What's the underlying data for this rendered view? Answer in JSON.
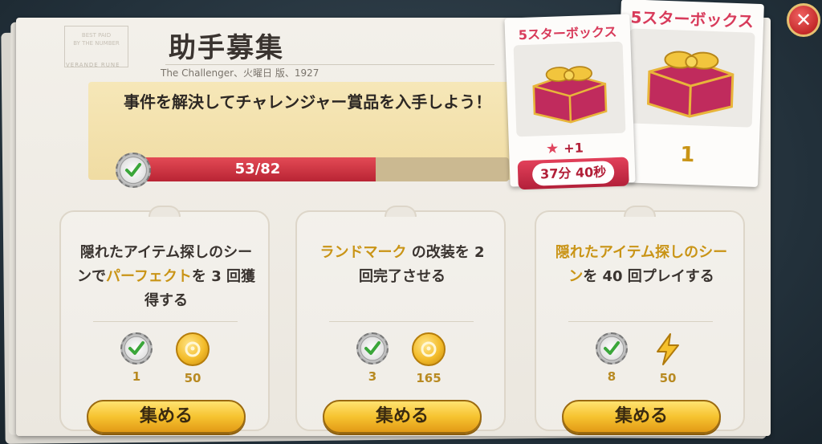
{
  "header": {
    "title": "助手募集",
    "subtitle": "The Challenger、火曜日 版、1927",
    "stamp_lines": [
      "BEST PAID",
      "BY THE NUMBER"
    ],
    "stamp_footer": "VERANDE RUNE"
  },
  "goal": {
    "text": "事件を解決してチャレンジャー賞品を入手しよう！",
    "progress_current": 53,
    "progress_total": 82,
    "progress_text": "53/82",
    "icon": "checkmark-badge-icon"
  },
  "tasks": [
    {
      "text_parts": [
        {
          "t": "隠れたアイテム探しのシーンで",
          "hl": false
        },
        {
          "t": "パーフェクト",
          "hl": true
        },
        {
          "t": "を 3 回獲得する",
          "hl": false
        }
      ],
      "rewards": [
        {
          "icon": "checkmark-badge-icon",
          "value": "1"
        },
        {
          "icon": "gold-coin-icon",
          "value": "50"
        }
      ],
      "button": "集める"
    },
    {
      "text_parts": [
        {
          "t": "ランドマーク",
          "hl": true
        },
        {
          "t": " の改装を 2 回完了させる",
          "hl": false
        }
      ],
      "rewards": [
        {
          "icon": "checkmark-badge-icon",
          "value": "3"
        },
        {
          "icon": "gold-coin-icon",
          "value": "165"
        }
      ],
      "button": "集める"
    },
    {
      "text_parts": [
        {
          "t": "隠れたアイテム探しのシーン",
          "hl": true
        },
        {
          "t": "を 40 回プレイする",
          "hl": false
        }
      ],
      "rewards": [
        {
          "icon": "checkmark-badge-icon",
          "value": "8"
        },
        {
          "icon": "lightning-bolt-icon",
          "value": "50"
        }
      ],
      "button": "集める"
    }
  ],
  "prizes": {
    "current": {
      "label": "5スターボックス",
      "bonus": "+1",
      "timer": "37分 40秒",
      "icon": "gift-box-icon"
    },
    "next": {
      "label": "5スターボックス",
      "count": "1",
      "icon": "gift-box-icon"
    }
  },
  "close": {
    "icon": "close-icon",
    "glyph": "✕"
  },
  "colors": {
    "accent": "#c99416",
    "progress": "#d8333f",
    "ribbon": "#c2283f"
  }
}
